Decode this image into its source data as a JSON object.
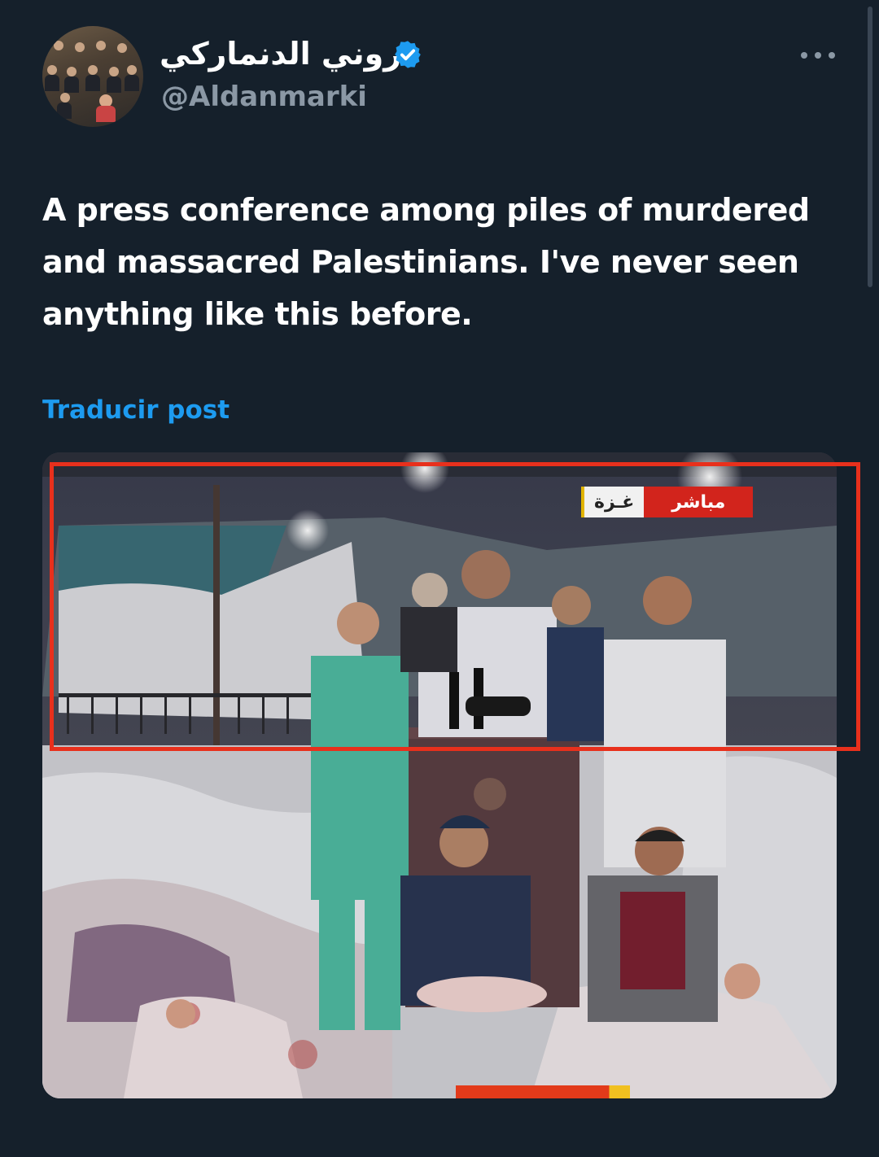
{
  "header": {
    "display_name": "روني الدنماركي",
    "handle": "@Aldanmarki",
    "verified_icon": "verified-badge-icon",
    "more_icon": "more-options-icon"
  },
  "tweet": {
    "text": "A press conference among piles of murdered and massacred Palestinians. I've never seen anything like this before.",
    "translate_label": "Traducir post"
  },
  "media": {
    "description_icon": "photo",
    "overlay": {
      "live_label": "مباشر",
      "location_label": "غـزة"
    },
    "highlight_color": "#e8301c"
  },
  "colors": {
    "background": "#15202b",
    "accent": "#1d9bf0",
    "secondary_text": "#8b98a5"
  }
}
